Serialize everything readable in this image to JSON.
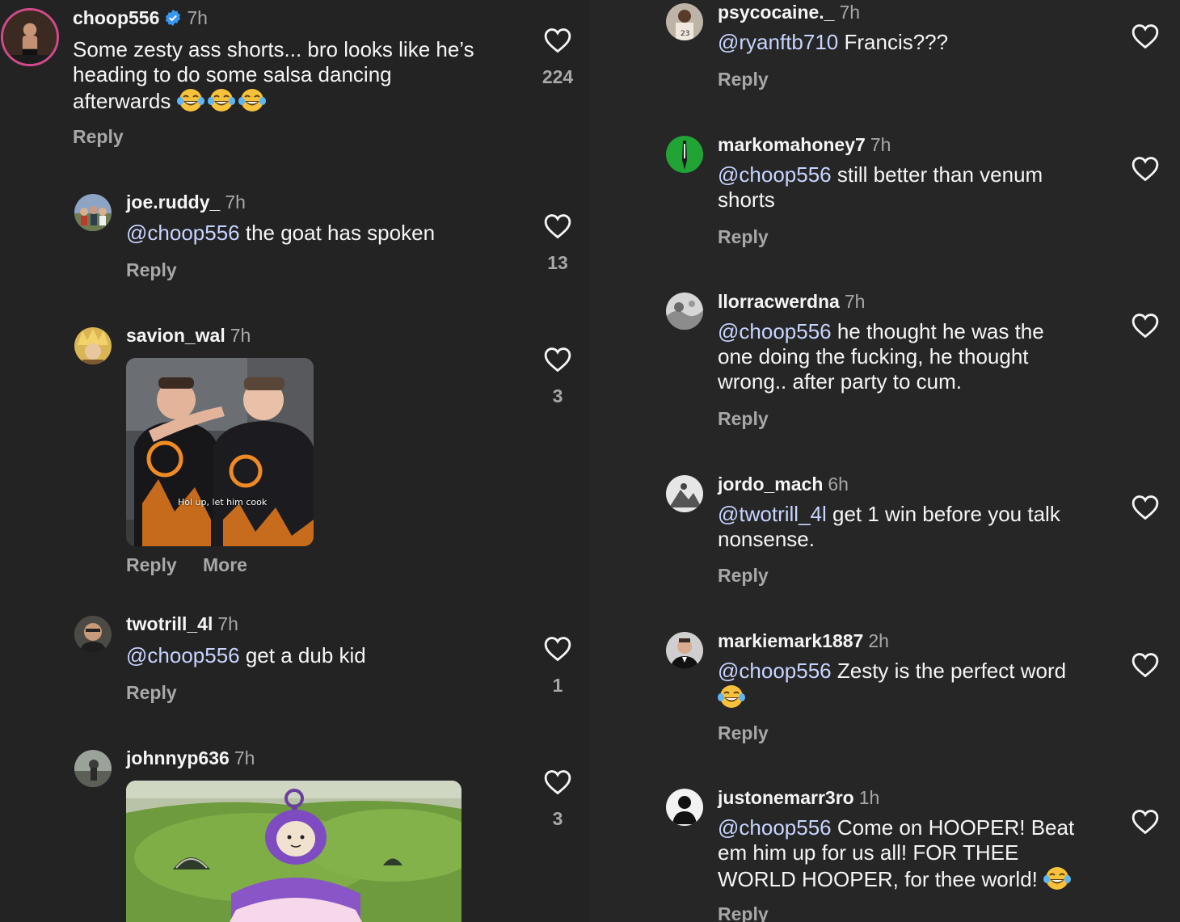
{
  "left": [
    {
      "id": "choop",
      "username": "choop556",
      "verified": true,
      "time": "7h",
      "lines": [
        "Some zesty ass shorts... bro looks like he’s",
        "heading to do some salsa dancing",
        "afterwards"
      ],
      "reply_label": "Reply",
      "likes": "224"
    },
    {
      "id": "joe",
      "username": "joe.ruddy_",
      "time": "7h",
      "mention": "@choop556",
      "text": " the goat has spoken",
      "reply_label": "Reply",
      "likes": "13"
    },
    {
      "id": "savion",
      "username": "savion_wal",
      "time": "7h",
      "gif_caption": "Hol up, let him cook",
      "reply_label": "Reply",
      "more_label": "More",
      "likes": "3"
    },
    {
      "id": "twotrill",
      "username": "twotrill_4l",
      "time": "7h",
      "mention": "@choop556",
      "text": " get a dub kid",
      "reply_label": "Reply",
      "likes": "1"
    },
    {
      "id": "johnny",
      "username": "johnnyp636",
      "time": "7h",
      "likes": "3"
    }
  ],
  "right": [
    {
      "id": "psy",
      "username": "psycocaine._",
      "time": "7h",
      "mention": "@ryanftb710",
      "text": " Francis???",
      "reply_label": "Reply"
    },
    {
      "id": "marko",
      "username": "markomahoney7",
      "time": "7h",
      "mention": "@choop556",
      "text_line1": " still better than venum",
      "text_line2": "shorts",
      "reply_label": "Reply"
    },
    {
      "id": "llorr",
      "username": "llorracwerdna",
      "time": "7h",
      "mention": "@choop556",
      "text_line1": " he thought he was the",
      "text_line2": "one doing the fucking,  he thought",
      "text_line3": "wrong.. after party to cum.",
      "reply_label": "Reply"
    },
    {
      "id": "jordo",
      "username": "jordo_mach",
      "time": "6h",
      "mention": "@twotrill_4l",
      "text_line1": " get 1 win before you talk",
      "text_line2": "nonsense.",
      "reply_label": "Reply"
    },
    {
      "id": "markie",
      "username": "markiemark1887",
      "time": "2h",
      "mention": "@choop556",
      "text_line1": " Zesty is the perfect word",
      "reply_label": "Reply"
    },
    {
      "id": "juston",
      "username": "justonemarr3ro",
      "time": "1h",
      "mention": "@choop556",
      "text_line1": " Come on HOOPER! Beat",
      "text_line2": "em him up for us all! FOR THEE",
      "text_line3": "WORLD HOOPER, for thee world!",
      "reply_label": "Reply"
    }
  ],
  "colors": {
    "background": "#262626",
    "mention": "#c7d4ff",
    "secondary_text": "#a8a8a8",
    "verified_badge": "#3897f0"
  },
  "icons": {
    "like": "heart-outline-icon",
    "verified": "verified-badge-icon",
    "emoji": "tears-of-joy-emoji"
  }
}
